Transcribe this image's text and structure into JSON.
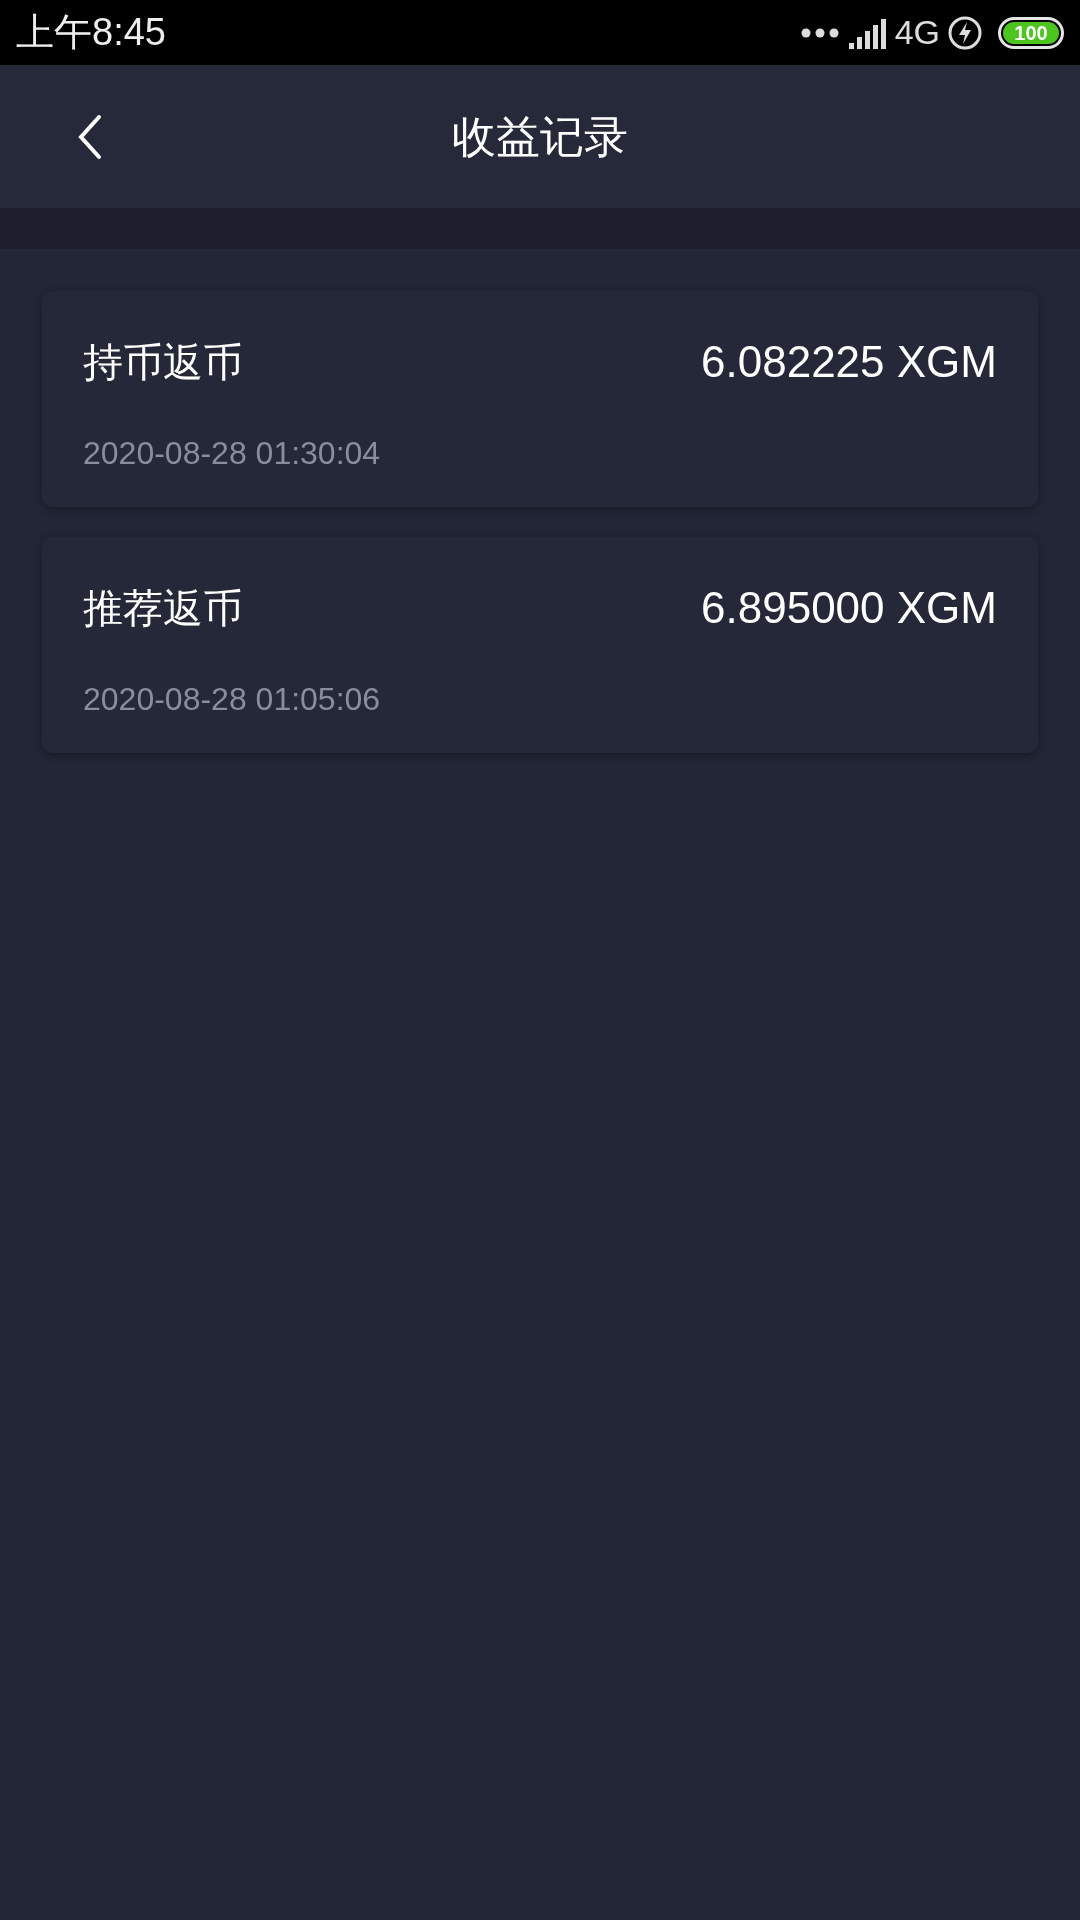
{
  "status_bar": {
    "time": "上午8:45",
    "network": "4G",
    "battery": "100"
  },
  "header": {
    "title": "收益记录"
  },
  "records": [
    {
      "label": "持币返币",
      "amount": "6.082225 XGM",
      "time": "2020-08-28 01:30:04"
    },
    {
      "label": "推荐返币",
      "amount": "6.895000 XGM",
      "time": "2020-08-28 01:05:06"
    }
  ]
}
